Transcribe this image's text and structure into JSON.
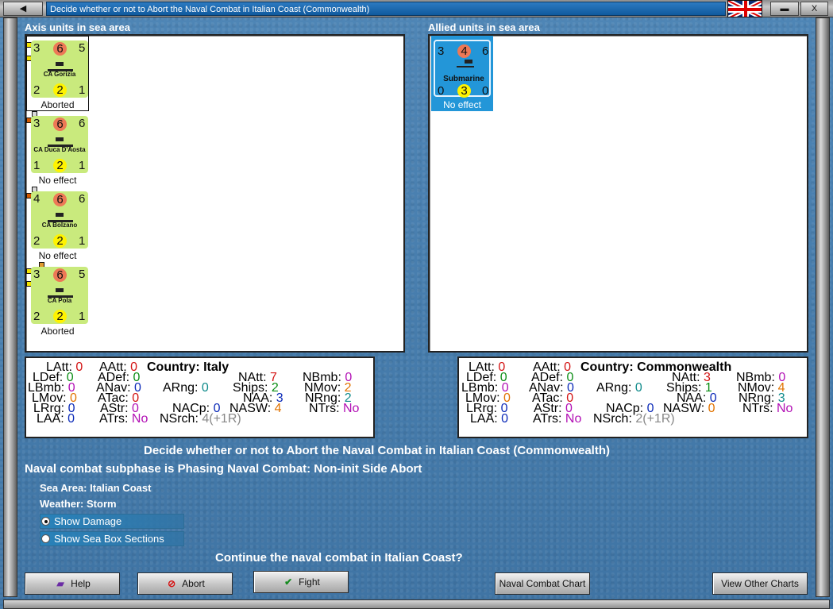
{
  "window": {
    "title": "Decide whether or not to Abort the Naval Combat in Italian Coast (Commonwealth)",
    "left_button": "◀",
    "right_buttons": [
      "▬",
      "X"
    ]
  },
  "axis": {
    "label": "Axis units in sea area",
    "units": [
      {
        "left": "3",
        "center": "6",
        "right": "5",
        "name": "CA Gorizia",
        "bottom_left": "2",
        "bottom_center": "2",
        "bottom_right": "1",
        "status": "Aborted",
        "marker_color": "#f4e500"
      },
      {
        "left": "3",
        "center": "6",
        "right": "6",
        "name": "CA Duca D'Aosta",
        "bottom_left": "1",
        "bottom_center": "2",
        "bottom_right": "1",
        "status": "No effect",
        "marker_color": "#d35800"
      },
      {
        "left": "4",
        "center": "6",
        "right": "6",
        "name": "CA Bolzano",
        "bottom_left": "2",
        "bottom_center": "2",
        "bottom_right": "1",
        "status": "No effect",
        "marker_color": "#d35800"
      },
      {
        "left": "3",
        "center": "6",
        "right": "5",
        "name": "CA Pola",
        "bottom_left": "2",
        "bottom_center": "2",
        "bottom_right": "1",
        "status": "Aborted",
        "marker_color": "#f4e500"
      }
    ],
    "stats": {
      "country_label": "Country:",
      "country": "Italy",
      "LAtt": "0",
      "LDef": "0",
      "LBmb": "0",
      "LMov": "0",
      "LRrg": "0",
      "LAA": "0",
      "AAtt": "0",
      "ADef": "0",
      "ANav": "0",
      "ATac": "0",
      "AStr": "0",
      "ATrs": "No",
      "ARng": "0",
      "NACp": "0",
      "NSrch": "4(+1R)",
      "NAtt": "7",
      "Ships": "2",
      "NAA": "3",
      "NASW": "4",
      "NBmb": "0",
      "NMov": "2",
      "NRng": "2",
      "NTrs": "No"
    }
  },
  "allied": {
    "label": "Allied units in sea area",
    "units": [
      {
        "left": "3",
        "center": "4",
        "right": "6",
        "name": "Submarine",
        "bottom_left": "0",
        "bottom_center": "3",
        "bottom_right": "0",
        "status": "No effect"
      }
    ],
    "stats": {
      "country_label": "Country:",
      "country": "Commonwealth",
      "LAtt": "0",
      "LDef": "0",
      "LBmb": "0",
      "LMov": "0",
      "LRrg": "0",
      "LAA": "0",
      "AAtt": "0",
      "ADef": "0",
      "ANav": "0",
      "ATac": "0",
      "AStr": "0",
      "ATrs": "No",
      "ARng": "0",
      "NACp": "0",
      "NSrch": "2(+1R)",
      "NAtt": "3",
      "Ships": "1",
      "NAA": "0",
      "NASW": "0",
      "NBmb": "0",
      "NMov": "4",
      "NRng": "3",
      "NTrs": "No"
    }
  },
  "main": {
    "decision_heading": "Decide whether or not to Abort the Naval Combat in Italian Coast (Commonwealth)",
    "subphase": "Naval combat subphase is Phasing Naval Combat: Non-init Side Abort",
    "sea_area_label": "Sea Area:",
    "sea_area": "Italian Coast",
    "weather_label": "Weather:",
    "weather": "Storm",
    "show_damage": "Show Damage",
    "show_sea_box": "Show Sea Box Sections",
    "question": "Continue the naval combat in Italian Coast?"
  },
  "buttons": {
    "help": "Help",
    "abort": "Abort",
    "fight": "Fight",
    "naval_chart": "Naval Combat Chart",
    "view_other": "View Other Charts"
  },
  "colors": {
    "axis_counter": "#c9ea7d",
    "allied_counter": "#2396d8",
    "selection": "#2396d8"
  }
}
